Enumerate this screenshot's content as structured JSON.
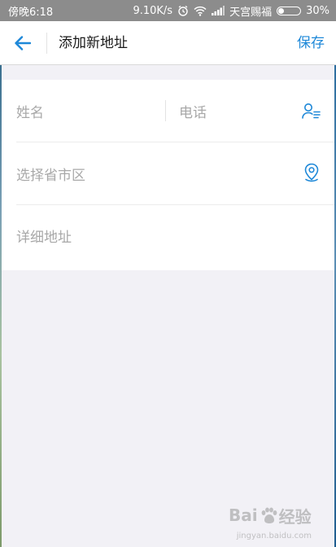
{
  "status_bar": {
    "time": "傍晚6:18",
    "speed": "9.10K/s",
    "carrier": "天宫赐福",
    "battery": "30%",
    "battery_level": 0.3
  },
  "header": {
    "title": "添加新地址",
    "save_label": "保存",
    "back_icon": "arrow-left-icon"
  },
  "form": {
    "name_placeholder": "姓名",
    "phone_placeholder": "电话",
    "region_placeholder": "选择省市区",
    "address_placeholder": "详细地址",
    "contact_icon": "contact-book-icon",
    "location_icon": "location-pin-icon"
  },
  "watermark": {
    "brand": "Bai",
    "suffix": "经验",
    "url": "jingyan.baidu.com"
  },
  "colors": {
    "accent": "#1e88d8",
    "placeholder": "#a8a8a8",
    "background": "#f2f1f6"
  }
}
